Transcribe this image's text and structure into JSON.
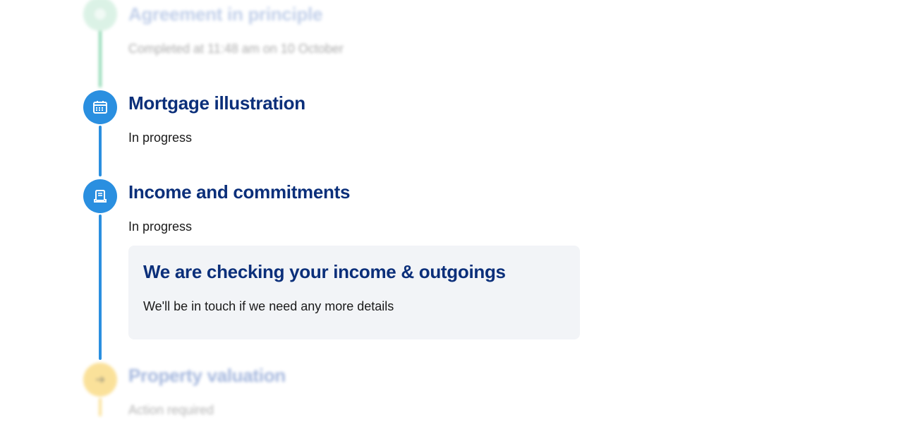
{
  "steps": [
    {
      "title": "Agreement in principle",
      "status": "Completed at 11:48 am on 10 October",
      "icon": "check-icon",
      "state": "completed",
      "color": "#2eb872"
    },
    {
      "title": "Mortgage illustration",
      "status": "In progress",
      "icon": "calendar-icon",
      "state": "in-progress",
      "color": "#2a8fe0"
    },
    {
      "title": "Income and commitments",
      "status": "In progress",
      "icon": "document-icon",
      "state": "in-progress",
      "color": "#2a8fe0",
      "card": {
        "title": "We are checking your income & outgoings",
        "body": "We'll be in touch if we need any more details"
      }
    },
    {
      "title": "Property valuation",
      "status": "Action required",
      "icon": "arrow-right-icon",
      "state": "action-required",
      "color": "#f7c948"
    }
  ],
  "colors": {
    "heading": "#0b2f7a",
    "text": "#1a1a1a",
    "card_background": "#f2f4f7",
    "accent_blue": "#2a8fe0",
    "accent_green": "#2eb872",
    "accent_yellow": "#f7c948"
  }
}
